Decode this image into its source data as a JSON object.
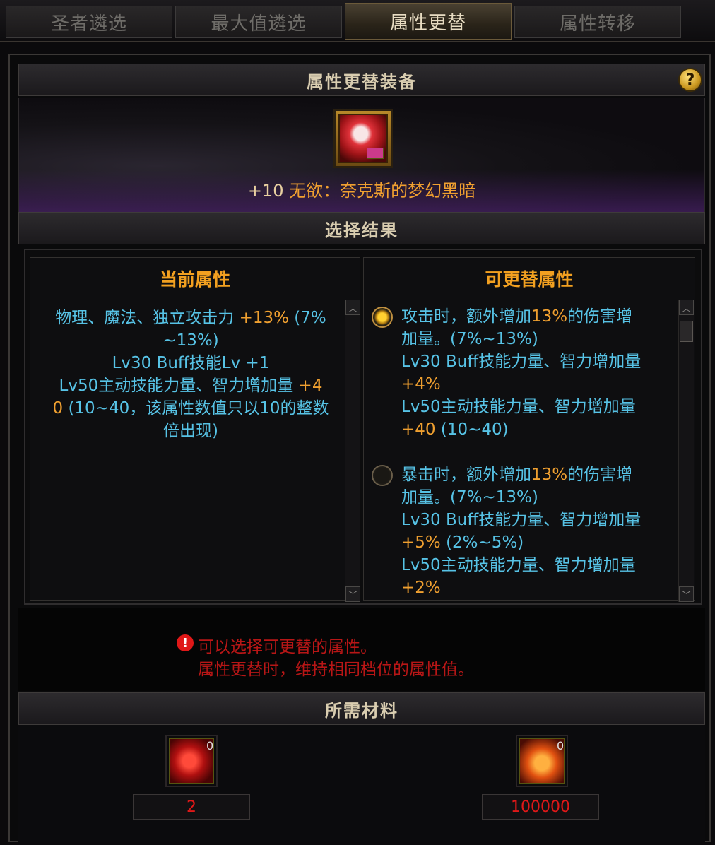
{
  "tabs": [
    "圣者遴选",
    "最大值遴选",
    "属性更替",
    "属性转移"
  ],
  "active_tab": 2,
  "header_equip": "属性更替装备",
  "help_label": "?",
  "equipment": {
    "level": "+10",
    "name": "无欲：奈克斯的梦幻黑暗",
    "icon": "nex-dream-darkness-icon"
  },
  "header_result": "选择结果",
  "current_panel": {
    "title": "当前属性",
    "lines": [
      {
        "text": "物理、魔法、独立攻击力 ",
        "hl": "+13%",
        "tail": " (7%"
      },
      {
        "text": "~13%)",
        "hl": "",
        "tail": ""
      },
      {
        "text": "Lv30 Buff技能Lv +1",
        "hl": "",
        "tail": ""
      },
      {
        "text": "Lv50主动技能力量、智力增加量 ",
        "hl": "+4",
        "tail": ""
      },
      {
        "text": "",
        "hl": "0",
        "tail": " (10~40，该属性数值只以10的整数"
      },
      {
        "text": "倍出现)",
        "hl": "",
        "tail": ""
      }
    ]
  },
  "options_panel": {
    "title": "可更替属性",
    "options": [
      {
        "selected": true,
        "lines": [
          {
            "text": "攻击时，额外增加",
            "hl": "13%",
            "tail": "的伤害增"
          },
          {
            "text": "加量。(7%~13%)",
            "hl": "",
            "tail": ""
          },
          {
            "text": "Lv30 Buff技能力量、智力增加量",
            "hl": "",
            "tail": ""
          },
          {
            "text": "",
            "hl": "+4%",
            "tail": ""
          },
          {
            "text": "Lv50主动技能力量、智力增加量",
            "hl": "",
            "tail": ""
          },
          {
            "text": "",
            "hl": "+40",
            "tail": " (10~40)"
          }
        ]
      },
      {
        "selected": false,
        "lines": [
          {
            "text": "暴击时，额外增加",
            "hl": "13%",
            "tail": "的伤害增"
          },
          {
            "text": "加量。(7%~13%)",
            "hl": "",
            "tail": ""
          },
          {
            "text": "Lv30 Buff技能力量、智力增加量",
            "hl": "",
            "tail": ""
          },
          {
            "text": "",
            "hl": "+5%",
            "tail": " (2%~5%)"
          },
          {
            "text": "Lv50主动技能力量、智力增加量",
            "hl": "",
            "tail": ""
          },
          {
            "text": "",
            "hl": "+2%",
            "tail": ""
          }
        ]
      }
    ]
  },
  "warning": {
    "icon": "!",
    "line1": "可以选择可更替的属性。",
    "line2": "属性更替时，维持相同档位的属性值。"
  },
  "header_materials": "所需材料",
  "materials": [
    {
      "icon": "red-crystal-icon",
      "owned": "0",
      "required": "2"
    },
    {
      "icon": "gold-coins-icon",
      "owned": "0",
      "required": "100000"
    }
  ],
  "colors": {
    "highlight": "#f0a030",
    "text": "#57c3e6",
    "warning": "#b81616",
    "title": "#f2a020"
  }
}
